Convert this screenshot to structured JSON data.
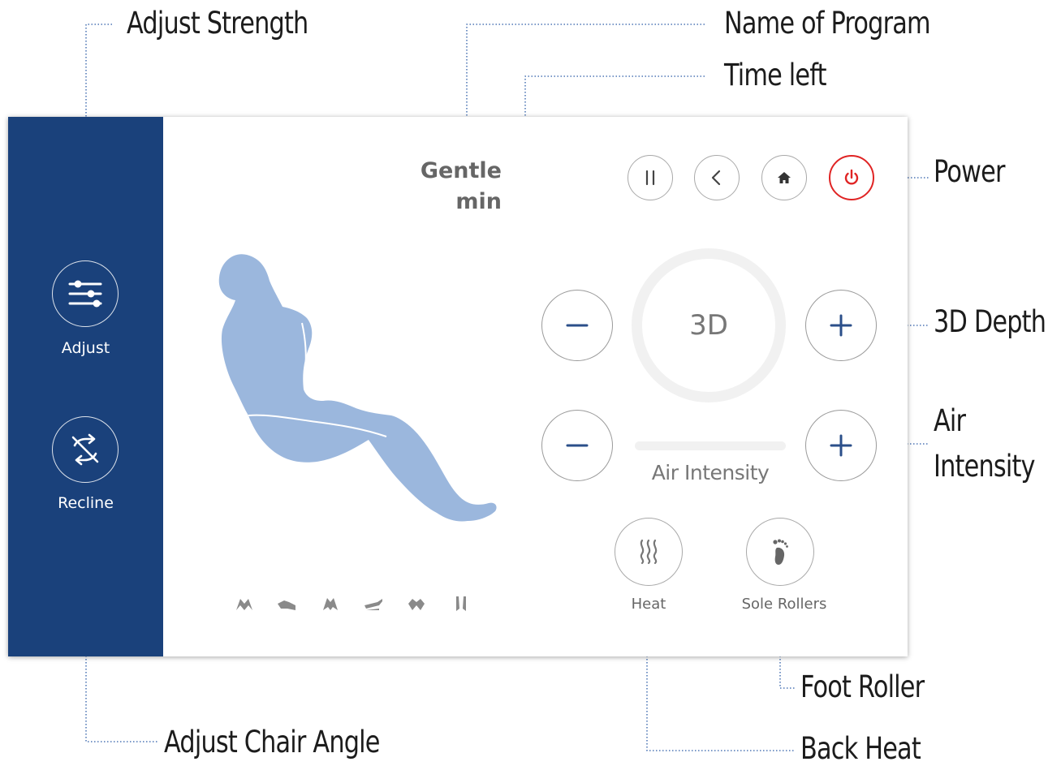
{
  "callouts": {
    "adjust_strength": "Adjust Strength",
    "name_of_program": "Name of Program",
    "time_left": "Time left",
    "power": "Power",
    "depth_3d": "3D Depth",
    "air_intensity_line1": "Air",
    "air_intensity_line2": "Intensity",
    "foot_roller": "Foot Roller",
    "adjust_chair_angle": "Adjust Chair Angle",
    "back_heat": "Back Heat"
  },
  "sidebar": {
    "items": [
      {
        "label": "Adjust",
        "icon": "sliders-icon"
      },
      {
        "label": "Recline",
        "icon": "recline-arrows-icon"
      }
    ]
  },
  "program": {
    "name": "Gentle",
    "time_unit": "min"
  },
  "top_buttons": [
    {
      "icon": "pause-icon"
    },
    {
      "icon": "back-icon"
    },
    {
      "icon": "home-icon"
    },
    {
      "icon": "power-icon"
    }
  ],
  "depth": {
    "label": "3D",
    "decrease_symbol": "−",
    "increase_symbol": "+"
  },
  "air": {
    "label": "Air Intensity",
    "decrease_symbol": "−",
    "increase_symbol": "+"
  },
  "features": [
    {
      "label": "Heat",
      "icon": "heat-waves-icon"
    },
    {
      "label": "Sole Rollers",
      "icon": "footprint-icon"
    }
  ],
  "body_areas": [
    "shoulder-icon",
    "arm-icon",
    "back-icon",
    "hand-icon",
    "calf-icon",
    "feet-icon"
  ],
  "colors": {
    "sidebar": "#1a417b",
    "accent": "#2b4f8a",
    "power": "#e02424",
    "figure": "#9bb7dd"
  }
}
